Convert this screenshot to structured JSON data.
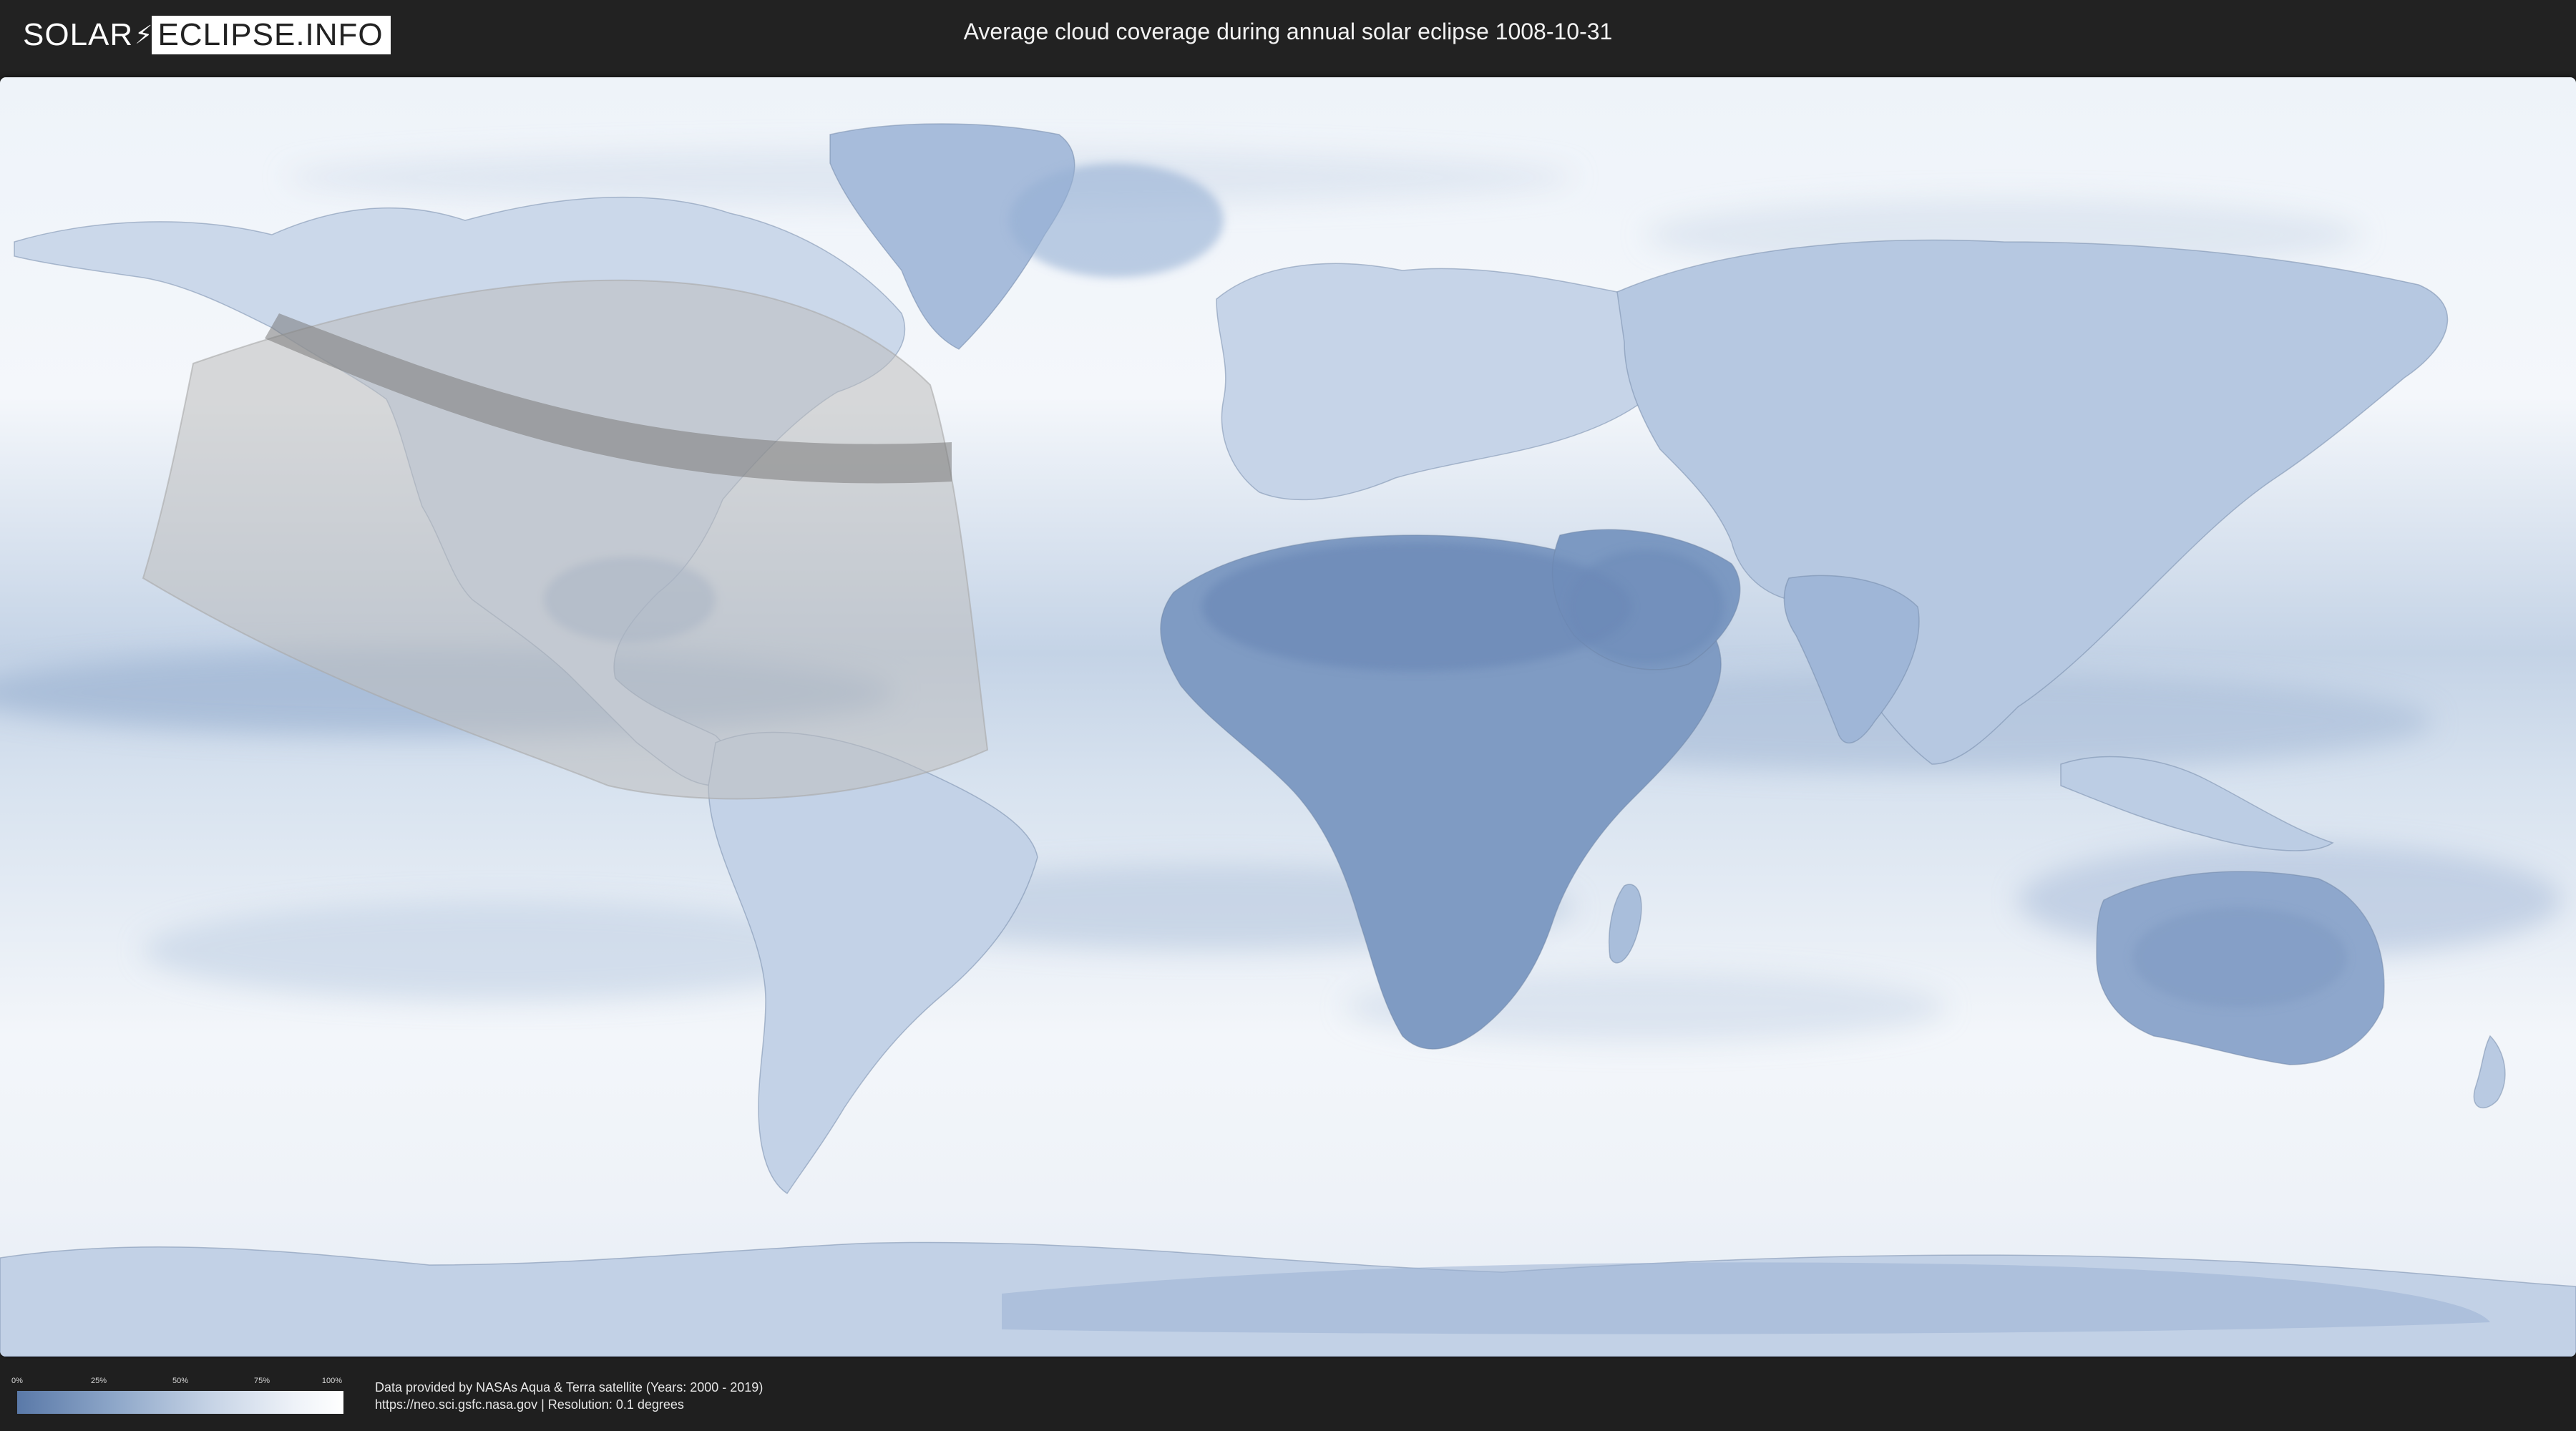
{
  "header": {
    "logo_part1": "SOLAR",
    "logo_part2": "ECLIPSE.INFO",
    "title": "Average cloud coverage during annual solar eclipse 1008-10-31"
  },
  "map": {
    "ocean_color": "#e8eef6",
    "cloud_low_color": "#5a79a8",
    "cloud_high_color": "#ffffff",
    "eclipse_region_color": "#bdbdbd",
    "annular_path_color": "#7a7a7a"
  },
  "legend": {
    "scale_labels": [
      "0%",
      "25%",
      "50%",
      "75%",
      "100%"
    ],
    "gradient_start": "#5a79a8",
    "gradient_end": "#ffffff"
  },
  "footer": {
    "credit_line1": "Data provided by NASAs Aqua & Terra satellite (Years: 2000 - 2019)",
    "credit_line2": "https://neo.sci.gsfc.nasa.gov | Resolution: 0.1 degrees"
  }
}
